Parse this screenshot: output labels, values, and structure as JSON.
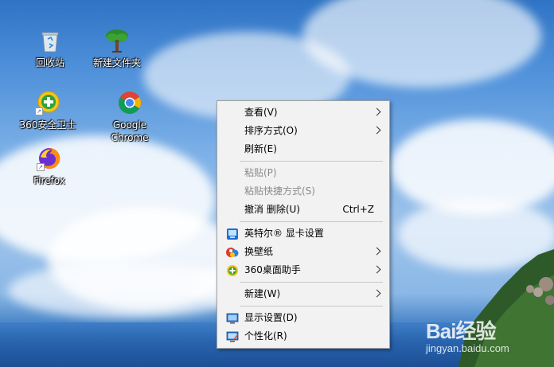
{
  "desktop_icons": [
    {
      "label": "回收站",
      "icon": "recycle-bin-icon"
    },
    {
      "label": "新建文件夹",
      "icon": "tree-folder-icon"
    },
    {
      "label": "360安全卫士",
      "icon": "360-safe-icon"
    },
    {
      "label": "Google\nChrome",
      "icon": "chrome-icon"
    },
    {
      "label": "Firefox",
      "icon": "firefox-icon"
    }
  ],
  "context_menu": {
    "view": "查看(V)",
    "sort": "排序方式(O)",
    "refresh": "刷新(E)",
    "paste": "粘贴(P)",
    "paste_shortcut": "粘贴快捷方式(S)",
    "undo_delete": "撤消 删除(U)",
    "undo_shortcut": "Ctrl+Z",
    "intel_graphics": "英特尔® 显卡设置",
    "wallpaper": "换壁纸",
    "desktop_helper": "360桌面助手",
    "new": "新建(W)",
    "display_settings": "显示设置(D)",
    "personalize": "个性化(R)"
  },
  "watermark": {
    "logo": "Bai经验",
    "url": "jingyan.baidu.com"
  }
}
